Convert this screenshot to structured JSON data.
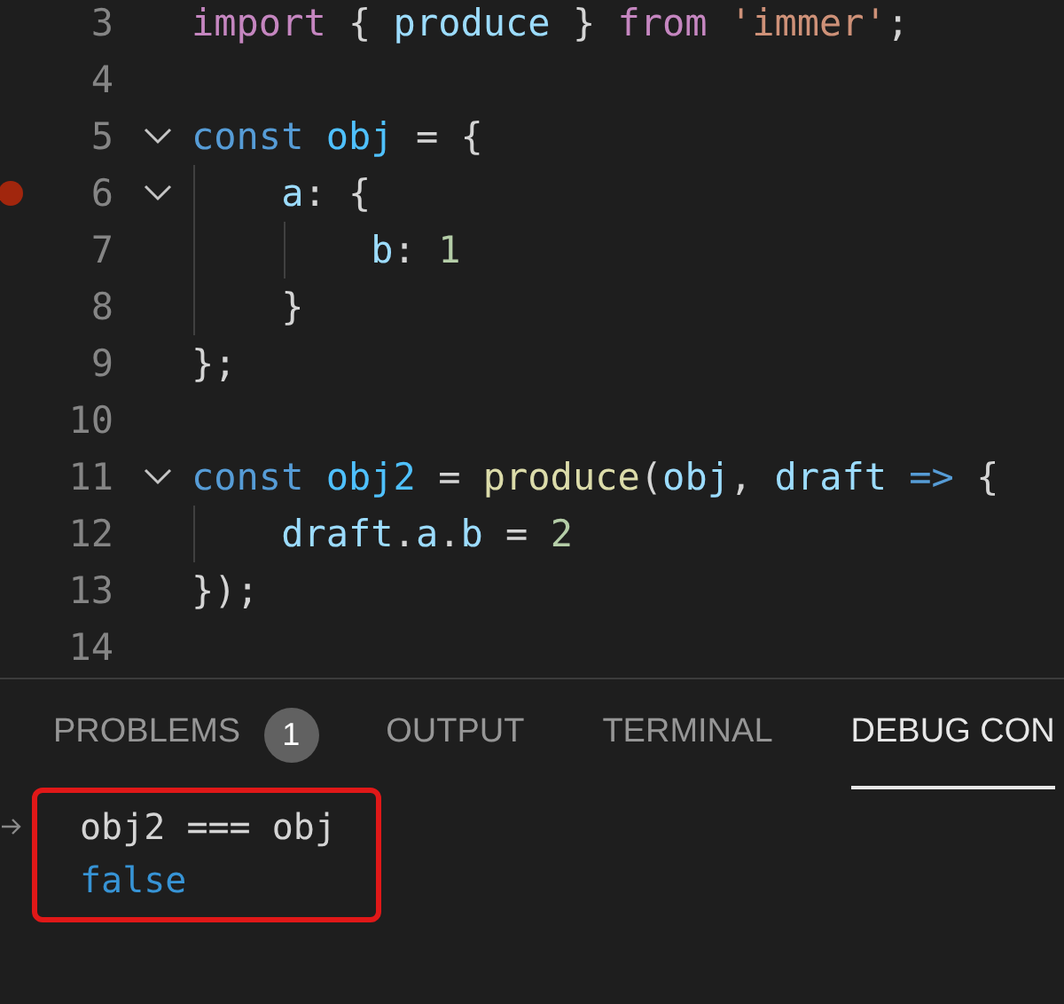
{
  "editor": {
    "lines": [
      {
        "number": "3",
        "breakpoint": false,
        "tokens": [
          {
            "kind": "keyword",
            "text": "import"
          },
          {
            "kind": "punct",
            "text": " { "
          },
          {
            "kind": "variable",
            "text": "produce"
          },
          {
            "kind": "punct",
            "text": " } "
          },
          {
            "kind": "keyword",
            "text": "from"
          },
          {
            "kind": "string",
            "text": " 'immer'"
          },
          {
            "kind": "punct",
            "text": ";"
          }
        ]
      },
      {
        "number": "4",
        "breakpoint": false
      },
      {
        "number": "5",
        "breakpoint": false,
        "expanded": true,
        "tokens": [
          {
            "kind": "storage",
            "text": "const "
          },
          {
            "kind": "constant",
            "text": "obj"
          },
          {
            "kind": "punct",
            "text": " = {"
          }
        ],
        "children": [
          {
            "number": "6",
            "breakpoint": true,
            "expanded": true,
            "tokens": [
              {
                "kind": "variable",
                "text": "a"
              },
              {
                "kind": "punct",
                "text": ": {"
              }
            ],
            "children": [
              {
                "number": "7",
                "breakpoint": false,
                "tokens": [
                  {
                    "kind": "variable",
                    "text": "b"
                  },
                  {
                    "kind": "punct",
                    "text": ": "
                  },
                  {
                    "kind": "number",
                    "text": "1"
                  }
                ]
              }
            ]
          },
          {
            "number": "8",
            "breakpoint": false,
            "tokens": [
              {
                "kind": "punct",
                "text": "}"
              }
            ]
          }
        ]
      },
      {
        "number": "9",
        "breakpoint": false,
        "tokens": [
          {
            "kind": "punct",
            "text": "};"
          }
        ]
      },
      {
        "number": "10",
        "breakpoint": false
      },
      {
        "number": "11",
        "breakpoint": false,
        "expanded": true,
        "tokens": [
          {
            "kind": "storage",
            "text": "const "
          },
          {
            "kind": "constant",
            "text": "obj2"
          },
          {
            "kind": "punct",
            "text": " = "
          },
          {
            "kind": "function",
            "text": "produce"
          },
          {
            "kind": "punct",
            "text": "("
          },
          {
            "kind": "variable",
            "text": "obj"
          },
          {
            "kind": "punct",
            "text": ", "
          },
          {
            "kind": "variable",
            "text": "draft "
          },
          {
            "kind": "storage",
            "text": "=>"
          },
          {
            "kind": "punct",
            "text": " {"
          }
        ],
        "children": [
          {
            "number": "12",
            "breakpoint": false,
            "tokens": [
              {
                "kind": "variable",
                "text": "draft"
              },
              {
                "kind": "punct",
                "text": "."
              },
              {
                "kind": "variable",
                "text": "a"
              },
              {
                "kind": "punct",
                "text": "."
              },
              {
                "kind": "variable",
                "text": "b"
              },
              {
                "kind": "punct",
                "text": " = "
              },
              {
                "kind": "number",
                "text": "2"
              }
            ]
          }
        ]
      },
      {
        "number": "13",
        "breakpoint": false,
        "tokens": [
          {
            "kind": "punct",
            "text": "});"
          }
        ]
      },
      {
        "number": "14",
        "breakpoint": false
      }
    ]
  },
  "panel": {
    "tabs": [
      {
        "label": "PROBLEMS",
        "badge": "1",
        "selected": false
      },
      {
        "label": "OUTPUT",
        "selected": false
      },
      {
        "label": "TERMINAL",
        "selected": false
      },
      {
        "label": "DEBUG CON",
        "selected": true
      }
    ],
    "console": {
      "highlighted": true,
      "entries": [
        {
          "kind": "input",
          "text": "obj2 === obj"
        },
        {
          "kind": "result",
          "text": "false"
        }
      ]
    }
  }
}
